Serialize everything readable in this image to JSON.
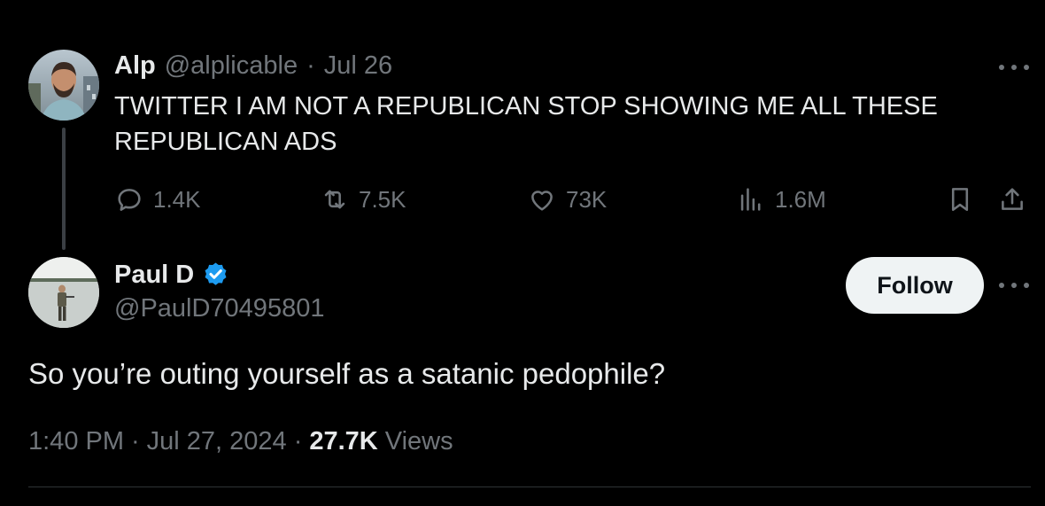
{
  "colors": {
    "background": "#000000",
    "text_primary": "#e7e9ea",
    "text_muted": "#71767b",
    "verified_blue": "#1d9bf0",
    "follow_button_bg": "#eff3f4",
    "divider": "#2f3336"
  },
  "parent_tweet": {
    "author_name": "Alp",
    "author_handle": "@alplicable",
    "separator": "·",
    "date": "Jul 26",
    "text": "TWITTER I AM NOT A REPUBLICAN STOP SHOWING ME ALL THESE REPUBLICAN ADS",
    "more_icon": "more-horizontal-icon",
    "actions": {
      "replies": "1.4K",
      "retweets": "7.5K",
      "likes": "73K",
      "views": "1.6M"
    },
    "icons": {
      "reply": "reply-icon",
      "retweet": "retweet-icon",
      "like": "heart-icon",
      "views": "analytics-icon",
      "bookmark": "bookmark-icon",
      "share": "share-icon"
    }
  },
  "reply_tweet": {
    "author_name": "Paul D",
    "verified_icon": "verified-badge-icon",
    "author_handle": "@PaulD70495801",
    "follow_label": "Follow",
    "more_icon": "more-horizontal-icon",
    "text": "So you’re outing yourself as a satanic pedophile?",
    "time": "1:40 PM",
    "separator": "·",
    "date": "Jul 27, 2024",
    "views_count": "27.7K",
    "views_label": "Views"
  }
}
